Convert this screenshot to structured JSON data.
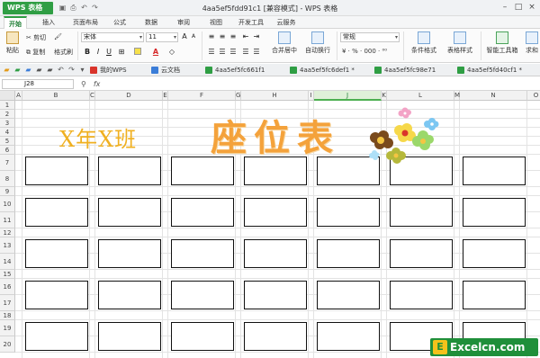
{
  "app": {
    "button_label": "WPS 表格",
    "window_title": "4aa5ef5fdd91c1 [兼容模式] - WPS 表格"
  },
  "menu": [
    "开始",
    "插入",
    "页面布局",
    "公式",
    "数据",
    "审阅",
    "视图",
    "开发工具",
    "云服务"
  ],
  "ribbon": {
    "paste": "粘贴",
    "cut": "剪切",
    "copy": "复制",
    "format_painter": "格式刷",
    "font_name": "宋体",
    "font_size": "11",
    "merge_center": "合并居中",
    "wrap_text": "自动换行",
    "number_format": "常规",
    "conditional_format": "条件格式",
    "table_style": "表格样式",
    "smart_toolbox": "智能工具箱",
    "find": "求和"
  },
  "doc_tabs": [
    "我的WPS",
    "云文档",
    "4aa5ef5fc661f1",
    "4aa5ef5fc6def1 *",
    "4aa5ef5fc98e71",
    "4aa5ef5fd40cf1 *"
  ],
  "formula": {
    "cell_ref": "J28",
    "fx_label": "fx"
  },
  "columns": [
    "A",
    "B",
    "C",
    "D",
    "E",
    "F",
    "G",
    "H",
    "I",
    "J",
    "K",
    "L",
    "M",
    "N",
    "O"
  ],
  "rows": [
    "1",
    "2",
    "3",
    "4",
    "5",
    "6",
    "7",
    "8",
    "9",
    "10",
    "11",
    "12",
    "13",
    "14",
    "15",
    "16",
    "17",
    "18",
    "19",
    "20"
  ],
  "selected_column": "J",
  "sheet": {
    "class_label": "X年X班",
    "title": "座位表"
  },
  "watermark": "Excelcn.com",
  "colors": {
    "accent": "#2f9e44",
    "title": "#f4a23b",
    "class_label": "#f0b020"
  }
}
